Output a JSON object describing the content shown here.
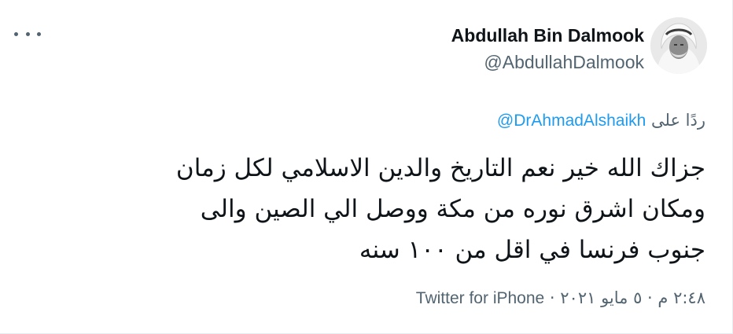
{
  "tweet": {
    "author": {
      "name": "Abdullah Bin Dalmook",
      "handle": "@AbdullahDalmook"
    },
    "replying_to": {
      "prefix": "ردًا على",
      "handle": "@DrAhmadAlshaikh"
    },
    "text_lines": [
      "جزاك الله خير نعم التاريخ والدين الاسلامي لكل زمان",
      "ومكان اشرق نوره من مكة ووصل الي الصين والى",
      "جنوب فرنسا في اقل من ١٠٠ سنه"
    ],
    "meta": {
      "time_date": "٢:٤٨ م · ٥ مايو ٢٠٢١",
      "separator": "·",
      "source": "Twitter for iPhone"
    }
  },
  "icons": {
    "more": "more-horizontal-icon",
    "avatar": "profile-photo"
  },
  "colors": {
    "link": "#1d9bf0",
    "secondary_text": "#536471",
    "primary_text": "#0f1419"
  }
}
